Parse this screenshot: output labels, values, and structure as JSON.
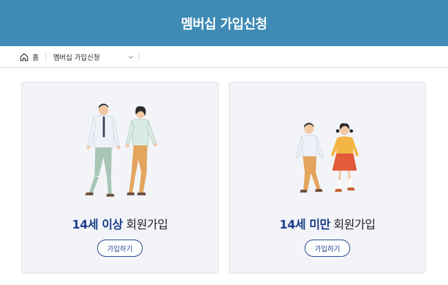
{
  "page": {
    "title": "멤버십 가입신청"
  },
  "breadcrumb": {
    "home": "홈",
    "current": "멤버십 가입신청"
  },
  "cards": [
    {
      "highlight": "14세 이상",
      "rest": " 회원가입",
      "button": "가입하기"
    },
    {
      "highlight": "14세 미만",
      "rest": " 회원가입",
      "button": "가입하기"
    }
  ],
  "colors": {
    "banner": "#3f8bb6",
    "accent": "#1e3f8a",
    "card_bg": "#f3f4f8"
  },
  "icons": {
    "home": "home-icon",
    "dropdown": "chevron-down-icon"
  }
}
